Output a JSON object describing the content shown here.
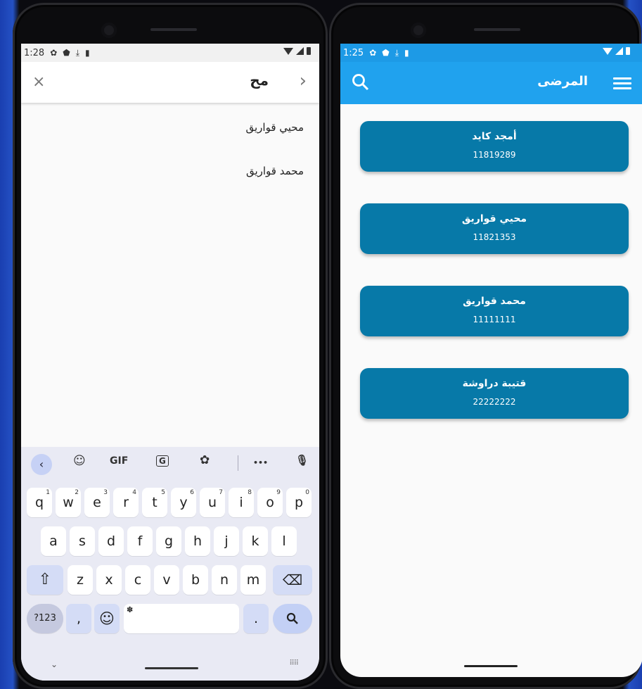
{
  "left_phone": {
    "status": {
      "time": "1:28"
    },
    "search": {
      "query": "مح",
      "close_icon": "×",
      "go_icon": "›"
    },
    "suggestions": [
      "محيي قواريق",
      "محمد قواريق"
    ],
    "keyboard": {
      "toolbar": {
        "back_icon": "‹",
        "sticker_icon": "☺",
        "gif": "GIF",
        "translate_icon": "G",
        "settings_icon": "✿",
        "more": "•••",
        "mic_icon": "🎙"
      },
      "row1": [
        {
          "key": "q",
          "hint": "1"
        },
        {
          "key": "w",
          "hint": "2"
        },
        {
          "key": "e",
          "hint": "3"
        },
        {
          "key": "r",
          "hint": "4"
        },
        {
          "key": "t",
          "hint": "5"
        },
        {
          "key": "y",
          "hint": "6"
        },
        {
          "key": "u",
          "hint": "7"
        },
        {
          "key": "i",
          "hint": "8"
        },
        {
          "key": "o",
          "hint": "9"
        },
        {
          "key": "p",
          "hint": "0"
        }
      ],
      "row2": [
        "a",
        "s",
        "d",
        "f",
        "g",
        "h",
        "j",
        "k",
        "l"
      ],
      "row3": [
        "z",
        "x",
        "c",
        "v",
        "b",
        "n",
        "m"
      ],
      "shift_icon": "⇧",
      "backspace_icon": "⌫",
      "symbols": "?123",
      "comma": ",",
      "emoji_icon": "☺",
      "period": ".",
      "search_icon": "🔍",
      "nav_chevron": "⌄",
      "nav_keyboard_icon": "⠿⠿"
    }
  },
  "right_phone": {
    "status": {
      "time": "1:25"
    },
    "appbar": {
      "title": "المرضى",
      "accent": "#20a2ee"
    },
    "patients": [
      {
        "name": "أمجد كايد",
        "id": "11819289"
      },
      {
        "name": "محيي قواريق",
        "id": "11821353"
      },
      {
        "name": "محمد قواريق",
        "id": "11111111"
      },
      {
        "name": "قتيبة دراوشة",
        "id": "22222222"
      }
    ],
    "card_color": "#0779a8"
  }
}
